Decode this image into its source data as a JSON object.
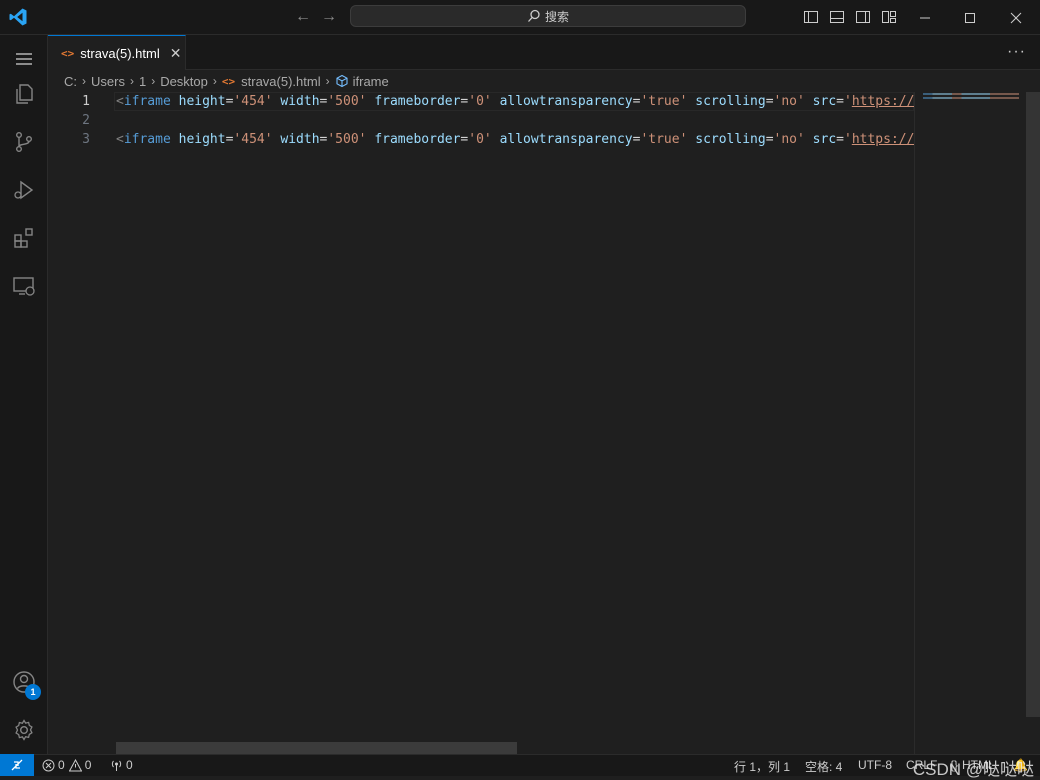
{
  "titlebar": {
    "search_label": "搜索"
  },
  "tabs": [
    {
      "label": "strava(5).html",
      "icon": "html-file-icon"
    }
  ],
  "breadcrumb": {
    "items": [
      "C:",
      "Users",
      "1",
      "Desktop",
      "strava(5).html",
      "iframe"
    ]
  },
  "editor": {
    "lines": [
      {
        "number": "1",
        "active": true,
        "tokens": [
          [
            "br",
            "<"
          ],
          [
            "tag",
            "iframe"
          ],
          [
            "sp",
            " "
          ],
          [
            "attr",
            "height"
          ],
          [
            "eq",
            "="
          ],
          [
            "str",
            "'454'"
          ],
          [
            "sp",
            " "
          ],
          [
            "attr",
            "width"
          ],
          [
            "eq",
            "="
          ],
          [
            "str",
            "'500'"
          ],
          [
            "sp",
            " "
          ],
          [
            "attr",
            "frameborder"
          ],
          [
            "eq",
            "="
          ],
          [
            "str",
            "'0'"
          ],
          [
            "sp",
            " "
          ],
          [
            "attr",
            "allowtransparency"
          ],
          [
            "eq",
            "="
          ],
          [
            "str",
            "'true'"
          ],
          [
            "sp",
            " "
          ],
          [
            "attr",
            "scrolling"
          ],
          [
            "eq",
            "="
          ],
          [
            "str",
            "'no'"
          ],
          [
            "sp",
            " "
          ],
          [
            "attr",
            "src"
          ],
          [
            "eq",
            "="
          ],
          [
            "str",
            "'"
          ],
          [
            "url",
            "https://www.strava.com"
          ]
        ]
      },
      {
        "number": "2",
        "active": false,
        "tokens": []
      },
      {
        "number": "3",
        "active": false,
        "tokens": [
          [
            "br",
            "<"
          ],
          [
            "tag",
            "iframe"
          ],
          [
            "sp",
            " "
          ],
          [
            "attr",
            "height"
          ],
          [
            "eq",
            "="
          ],
          [
            "str",
            "'454'"
          ],
          [
            "sp",
            " "
          ],
          [
            "attr",
            "width"
          ],
          [
            "eq",
            "="
          ],
          [
            "str",
            "'500'"
          ],
          [
            "sp",
            " "
          ],
          [
            "attr",
            "frameborder"
          ],
          [
            "eq",
            "="
          ],
          [
            "str",
            "'0'"
          ],
          [
            "sp",
            " "
          ],
          [
            "attr",
            "allowtransparency"
          ],
          [
            "eq",
            "="
          ],
          [
            "str",
            "'true'"
          ],
          [
            "sp",
            " "
          ],
          [
            "attr",
            "scrolling"
          ],
          [
            "eq",
            "="
          ],
          [
            "str",
            "'no'"
          ],
          [
            "sp",
            " "
          ],
          [
            "attr",
            "src"
          ],
          [
            "eq",
            "="
          ],
          [
            "str",
            "'"
          ],
          [
            "url",
            "https://www.strava.com"
          ]
        ]
      }
    ]
  },
  "activitybar": {
    "accounts_badge": "1"
  },
  "statusbar": {
    "errors": "0",
    "warnings": "0",
    "ports": "0",
    "position": "行 1，列 1",
    "indent": "空格: 4",
    "encoding": "UTF-8",
    "eol": "CRLF",
    "language": "HTML",
    "watermark": "CSDN @哒哒哒"
  },
  "colors": {
    "accent": "#0078d4",
    "html_icon": "#e37933"
  }
}
